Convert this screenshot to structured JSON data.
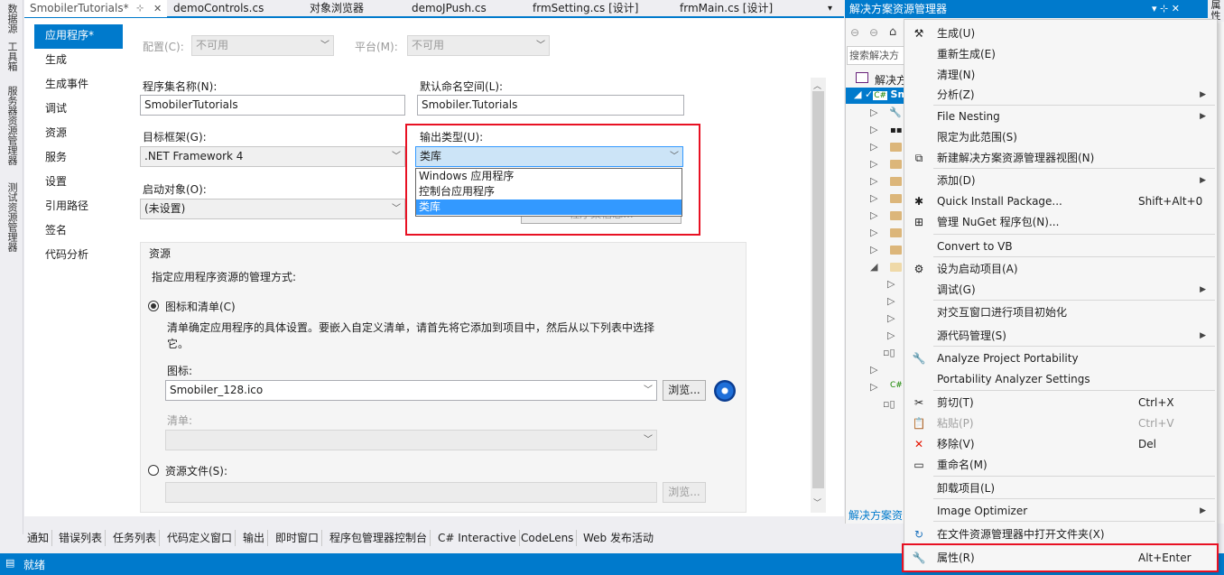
{
  "left_strip": [
    "数据源",
    "工具箱",
    "服务器资源管理器",
    "测试资源管理器"
  ],
  "doc_tabs": [
    {
      "label": "SmobilerTutorials*",
      "active": true,
      "pin": "⊹",
      "close": "✕"
    },
    {
      "label": "demoControls.cs"
    },
    {
      "label": "对象浏览器"
    },
    {
      "label": "demoJPush.cs"
    },
    {
      "label": "frmSetting.cs [设计]"
    },
    {
      "label": "frmMain.cs [设计]"
    }
  ],
  "tab_overflow": "▾",
  "nav": [
    "应用程序*",
    "生成",
    "生成事件",
    "调试",
    "资源",
    "服务",
    "设置",
    "引用路径",
    "签名",
    "代码分析"
  ],
  "config": {
    "label": "配置(C):",
    "value": "不可用"
  },
  "platform": {
    "label": "平台(M):",
    "value": "不可用"
  },
  "assembly_name": {
    "label": "程序集名称(N):",
    "value": "SmobilerTutorials"
  },
  "default_namespace": {
    "label": "默认命名空间(L):",
    "value": "Smobiler.Tutorials"
  },
  "target_framework": {
    "label": "目标框架(G):",
    "value": ".NET Framework 4"
  },
  "output_type": {
    "label": "输出类型(U):",
    "value": "类库",
    "options": [
      "Windows 应用程序",
      "控制台应用程序",
      "类库"
    ],
    "selected_index": 2
  },
  "startup_object": {
    "label": "启动对象(O):",
    "value": "(未设置)"
  },
  "hidden_button": "程序集信息...",
  "resources": {
    "title": "资源",
    "desc": "指定应用程序资源的管理方式:",
    "icon_manifest_radio": "图标和清单(C)",
    "explain": "清单确定应用程序的具体设置。要嵌入自定义清单，请首先将它添加到项目中，然后从以下列表中选择",
    "explain2": "它。",
    "icon_label": "图标:",
    "icon_value": "Smobiler_128.ico",
    "browse": "浏览...",
    "manifest_label": "清单:",
    "resource_file_radio": "资源文件(S):",
    "browse2": "浏览..."
  },
  "tool_tabs": [
    "通知",
    "错误列表",
    "任务列表",
    "代码定义窗口",
    "输出",
    "即时窗口",
    "程序包管理器控制台",
    "C# Interactive",
    "CodeLens",
    "Web 发布活动"
  ],
  "status": "就绪",
  "solution_explorer": {
    "title": "解决方案资源管理器",
    "title_icons": "▾ ⊹ ✕",
    "search_placeholder": "搜索解决方",
    "root": "解决方",
    "project": "Sm",
    "bottom_tab": "解决方案资"
  },
  "right_edge_tab": "属性",
  "context_menu": [
    {
      "label": "生成(U)",
      "icon": "build-icon",
      "glyph": "⚒"
    },
    {
      "label": "重新生成(E)"
    },
    {
      "label": "清理(N)"
    },
    {
      "label": "分析(Z)",
      "submenu": true
    },
    {
      "sep": true
    },
    {
      "label": "File Nesting",
      "submenu": true
    },
    {
      "label": "限定为此范围(S)"
    },
    {
      "label": "新建解决方案资源管理器视图(N)",
      "icon": "new-view-icon",
      "glyph": "⧉"
    },
    {
      "sep": true
    },
    {
      "label": "添加(D)",
      "submenu": true
    },
    {
      "label": "Quick Install Package...",
      "shortcut": "Shift+Alt+0",
      "icon": "quick-install-icon",
      "glyph": "✱"
    },
    {
      "label": "管理 NuGet 程序包(N)...",
      "icon": "nuget-icon",
      "glyph": "⊞"
    },
    {
      "sep": true
    },
    {
      "label": "Convert to VB"
    },
    {
      "sep": true
    },
    {
      "label": "设为启动项目(A)",
      "icon": "gear-icon",
      "glyph": "⚙"
    },
    {
      "label": "调试(G)",
      "submenu": true
    },
    {
      "sep": true
    },
    {
      "label": "对交互窗口进行项目初始化"
    },
    {
      "label": "源代码管理(S)",
      "submenu": true
    },
    {
      "sep": true
    },
    {
      "label": "Analyze Project Portability",
      "icon": "wrench-icon",
      "glyph": "🔧"
    },
    {
      "label": "Portability Analyzer Settings"
    },
    {
      "sep": true
    },
    {
      "label": "剪切(T)",
      "shortcut": "Ctrl+X",
      "icon": "scissors-icon",
      "glyph": "✂"
    },
    {
      "label": "粘贴(P)",
      "shortcut": "Ctrl+V",
      "icon": "paste-icon",
      "glyph": "📋",
      "disabled": true
    },
    {
      "label": "移除(V)",
      "shortcut": "Del",
      "icon": "remove-icon",
      "glyph": "✕",
      "color": "#e51400"
    },
    {
      "label": "重命名(M)",
      "icon": "rename-icon",
      "glyph": "▭"
    },
    {
      "sep": true
    },
    {
      "label": "卸载项目(L)"
    },
    {
      "sep": true
    },
    {
      "label": "Image Optimizer",
      "submenu": true
    },
    {
      "sep": true
    },
    {
      "label": "在文件资源管理器中打开文件夹(X)",
      "icon": "open-folder-icon",
      "glyph": "↻",
      "color": "#1e73be"
    },
    {
      "sep": true
    },
    {
      "label": "属性(R)",
      "shortcut": "Alt+Enter",
      "icon": "wrench-icon",
      "glyph": "🔧"
    }
  ],
  "colors": {
    "accent": "#007acc",
    "highlight": "#e81123",
    "selection": "#3399ff"
  }
}
